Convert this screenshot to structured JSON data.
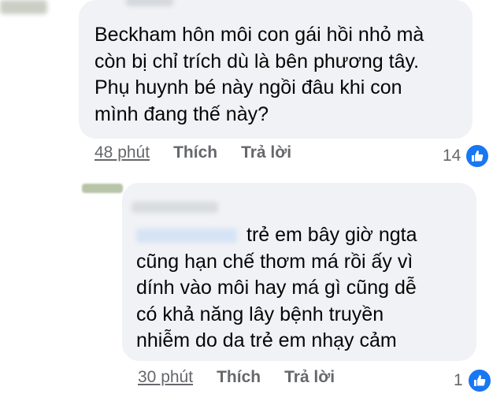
{
  "comments": [
    {
      "text": "Beckham hôn môi con gái hồi nhỏ mà\ncòn bị chỉ trích dù là bên phương tây.\nPhụ huynh bé này ngồi đâu khi con\nmình đang thế này?",
      "time": "48 phút",
      "like_label": "Thích",
      "reply_label": "Trả lời",
      "reaction_count": "14",
      "reaction_icon": "like-icon"
    },
    {
      "text": "trẻ em bây giờ ngta\ncũng hạn chế thơm má rồi ấy vì\ndính vào môi hay má gì cũng dễ\ncó khả năng lây bệnh truyền\nnhiễm do da trẻ em nhạy cảm",
      "time": "30 phút",
      "like_label": "Thích",
      "reply_label": "Trả lời",
      "reaction_count": "1",
      "reaction_icon": "like-icon"
    }
  ],
  "colors": {
    "bubble": "#f0f2f5",
    "meta_text": "#65676b",
    "like_blue": "#1877f2"
  }
}
